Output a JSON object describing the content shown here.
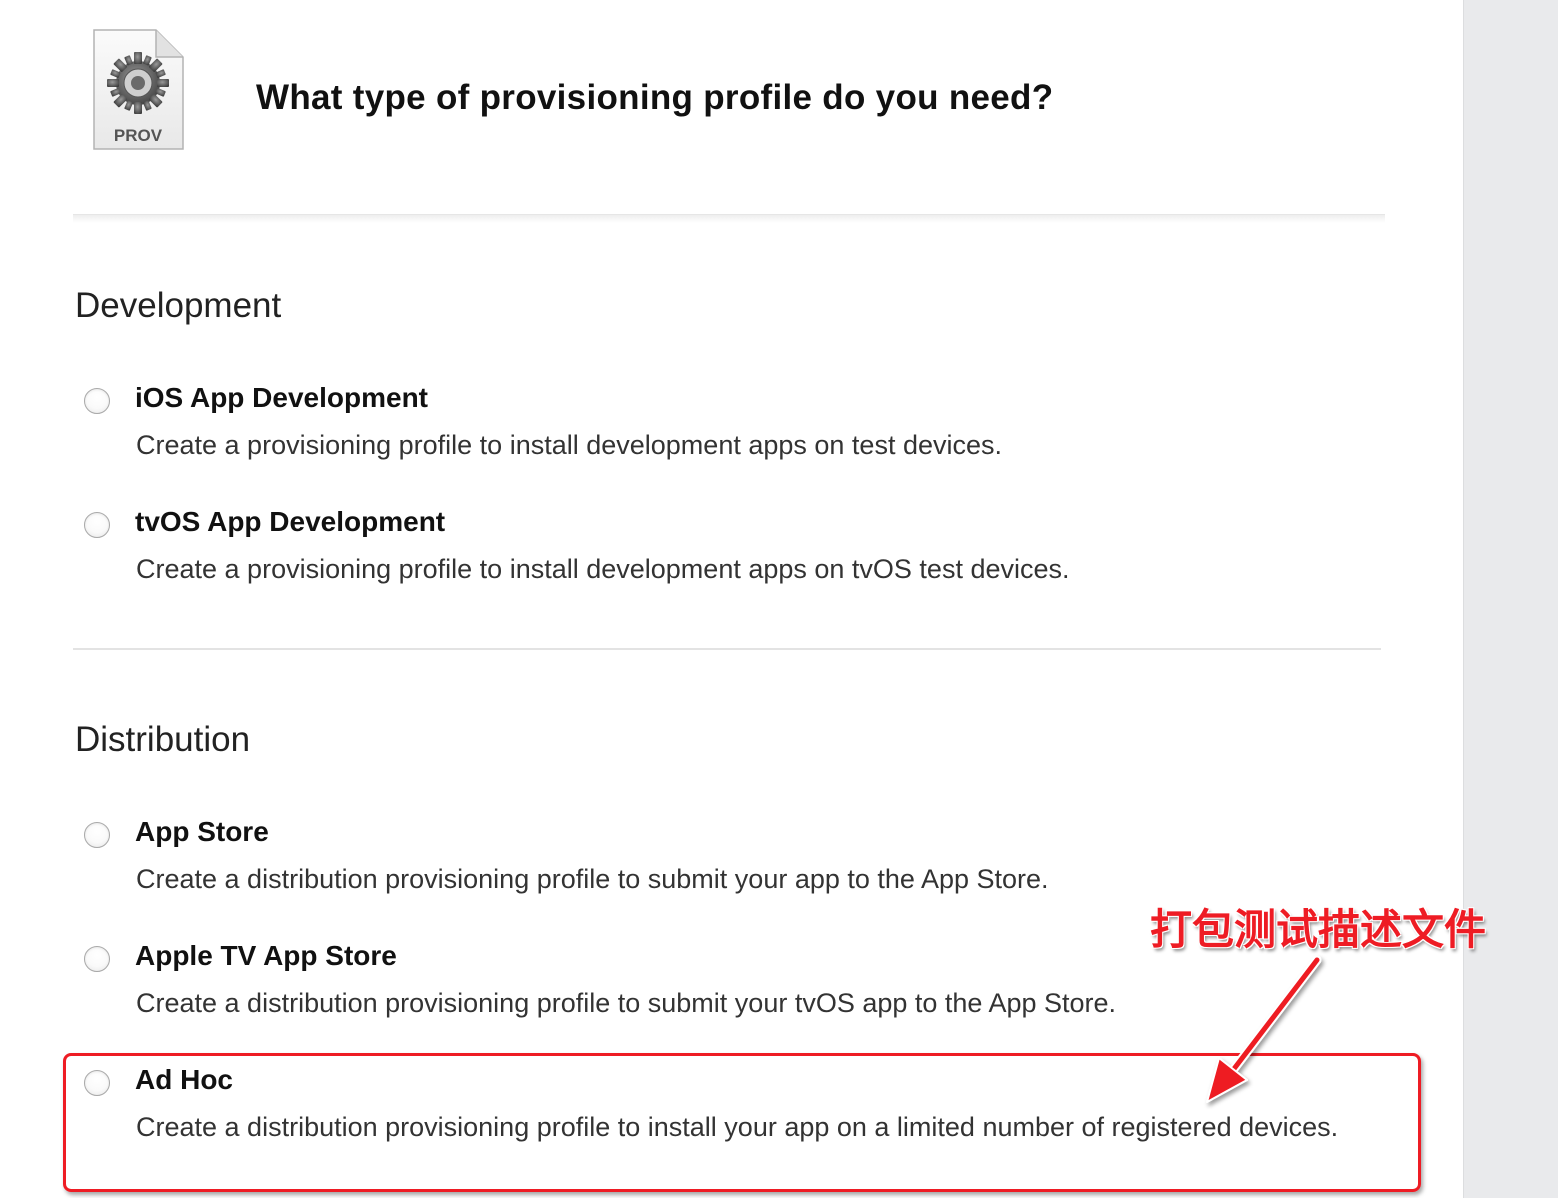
{
  "header": {
    "icon_label": "PROV",
    "title": "What type of provisioning profile do you need?"
  },
  "development": {
    "heading": "Development",
    "options": [
      {
        "title": "iOS App Development",
        "description": "Create a provisioning profile to install development apps on test devices.",
        "selected": false
      },
      {
        "title": "tvOS App Development",
        "description": "Create a provisioning profile to install development apps on tvOS test devices.",
        "selected": false
      }
    ]
  },
  "distribution": {
    "heading": "Distribution",
    "options": [
      {
        "title": "App Store",
        "description": "Create a distribution provisioning profile to submit your app to the App Store.",
        "selected": false
      },
      {
        "title": "Apple TV App Store",
        "description": "Create a distribution provisioning profile to submit your tvOS app to the App Store.",
        "selected": false
      },
      {
        "title": "Ad Hoc",
        "description": "Create a distribution provisioning profile to install your app on a limited number of registered devices.",
        "selected": false
      }
    ]
  },
  "annotation": {
    "text": "打包测试描述文件",
    "color": "#ee1c24"
  }
}
